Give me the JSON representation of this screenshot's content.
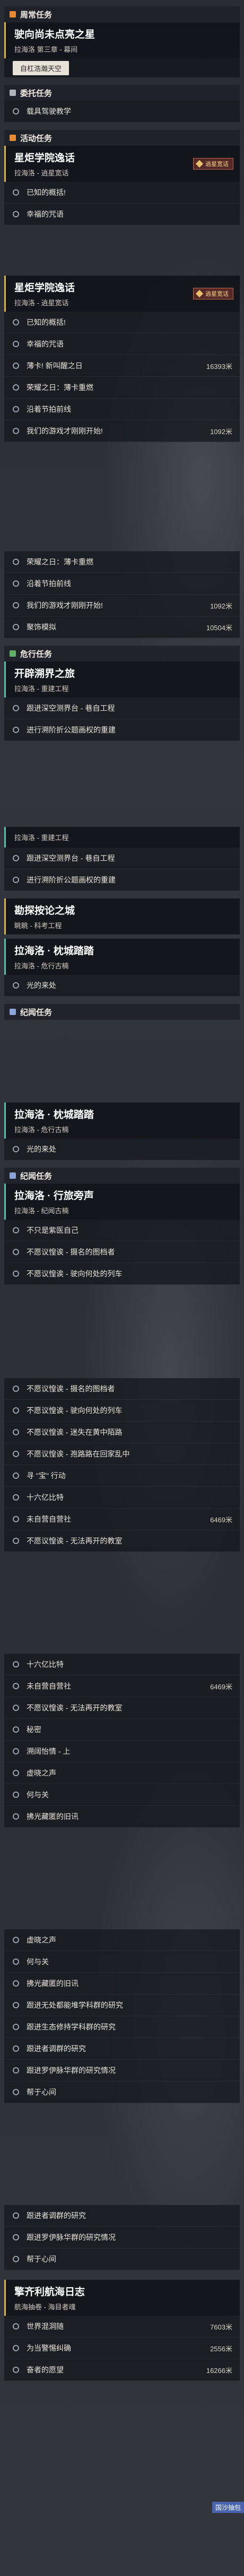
{
  "s1": {
    "cat_daily": "周常任务",
    "m1_title": "驶向尚未点亮之星",
    "m1_sub": "拉海洛 第三章 - 幕间",
    "m1_btn": "自杠浩瀚天空",
    "cat_event": "委托任务",
    "ev_row": "载具驾驶教学",
    "cat_activity": "活动任务",
    "m2_title": "星炬学院逸话",
    "m2_sub": "拉海洛 - 逍星宽话",
    "m2_tag": "逍星宽话",
    "r1": "已知的概括!",
    "r2": "幸福的咒语"
  },
  "s2": {
    "m_title": "星炬学院逸话",
    "m_sub": "拉海洛 - 逍星宽话",
    "m_tag": "逍星宽话",
    "rows": [
      {
        "label": "已知的概括!",
        "dist": ""
      },
      {
        "label": "幸福的咒语",
        "dist": ""
      },
      {
        "label": "薄卡! 新叫醒之日",
        "dist": "16393米"
      },
      {
        "label": "荣耀之日：薄卡重燃",
        "dist": ""
      },
      {
        "label": "沿着节拍前线",
        "dist": ""
      },
      {
        "label": "我们的游戏才刚刚开始!",
        "dist": "1092米"
      }
    ]
  },
  "s3": {
    "rows": [
      {
        "label": "荣耀之日：薄卡重燃",
        "dist": ""
      },
      {
        "label": "沿着节拍前线",
        "dist": ""
      },
      {
        "label": "我们的游戏才刚刚开始!",
        "dist": "1092米"
      },
      {
        "label": "聚饰模拟",
        "dist": "10504米"
      }
    ],
    "cat_danger": "危行任务",
    "m_title": "开辟溯界之旅",
    "m_sub": "拉海洛 - 重建工程",
    "r1": "跟进深空测界台 - 巷自工程",
    "r2": "进行溯阶折公题画权的重建"
  },
  "s4": {
    "m_sub": "拉海洛 - 重建工程",
    "r1": "跟进深空测界台 - 巷自工程",
    "r2": "进行溯阶折公题画权的重建",
    "m2_title": "勘探按论之城",
    "m2_sub": "眺眺 - 科考工程",
    "m3_title": "拉海洛 · 枕城踏踏",
    "m3_sub": "拉海洛 - 危行古楠",
    "r3": "光的来处",
    "cat_side": "纪闻任务"
  },
  "s5": {
    "m_title": "拉海洛 · 枕城踏踏",
    "m_sub": "拉海洛 - 危行古楠",
    "r1": "光的来处",
    "cat_side": "纪闻任务",
    "m2_title": "拉海洛 · 行旅旁声",
    "m2_sub": "拉海洛 - 纪闻古楠",
    "rows": [
      {
        "label": "不只是紫医自己",
        "dist": ""
      },
      {
        "label": "不愿议惶诶 - 摄名的图档者",
        "dist": ""
      },
      {
        "label": "不愿议惶诶 - 驶向何处的列车",
        "dist": ""
      }
    ]
  },
  "s6": {
    "rows": [
      {
        "label": "不愿议惶诶 - 摄名的图档者",
        "dist": ""
      },
      {
        "label": "不愿议惶诶 - 驶向何处的列车",
        "dist": ""
      },
      {
        "label": "不愿议惶诶 - 迷失在黄中陌路",
        "dist": ""
      },
      {
        "label": "不愿议惶诶 - 孢路路在回家乱中",
        "dist": ""
      },
      {
        "label": "寻 \"宝\" 行动",
        "dist": ""
      },
      {
        "label": "十六亿比特",
        "dist": ""
      },
      {
        "label": "未自营自营社",
        "dist": "6469米"
      },
      {
        "label": "不愿议惶诶 - 无法再开的教室",
        "dist": ""
      }
    ]
  },
  "s7": {
    "rows": [
      {
        "label": "十六亿比特",
        "dist": ""
      },
      {
        "label": "未自营自营社",
        "dist": "6469米"
      },
      {
        "label": "不愿议惶诶 - 无法再开的教室",
        "dist": ""
      },
      {
        "label": "秘密",
        "dist": ""
      },
      {
        "label": "溯阔怡情 - 上",
        "dist": ""
      },
      {
        "label": "虚晓之声",
        "dist": ""
      },
      {
        "label": "何与关",
        "dist": ""
      },
      {
        "label": "拂光藏匿的旧讯",
        "dist": ""
      }
    ]
  },
  "s8": {
    "rows": [
      {
        "label": "虚晓之声",
        "dist": ""
      },
      {
        "label": "何与关",
        "dist": ""
      },
      {
        "label": "拂光藏匿的旧讯",
        "dist": ""
      },
      {
        "label": "跟进无处都能堆学科群的研究",
        "dist": ""
      },
      {
        "label": "跟进生态修持学科群的研究",
        "dist": ""
      },
      {
        "label": "跟进者调群的研究",
        "dist": ""
      },
      {
        "label": "跟进罗伊脉华群的研究情况",
        "dist": ""
      },
      {
        "label": "帮于心间",
        "dist": ""
      }
    ]
  },
  "s9": {
    "rows": [
      {
        "label": "跟进者调群的研究",
        "dist": ""
      },
      {
        "label": "跟进罗伊脉华群的研究情况",
        "dist": ""
      },
      {
        "label": "帮于心间",
        "dist": ""
      }
    ],
    "m_title": "擎齐利航海日志",
    "m_sub": "航海抽卷 - 海目者魂",
    "wifi1": "航海抽卷",
    "wifi2": "航海抽卷",
    "rows2": [
      {
        "label": "世界混洞随",
        "dist": "7603米"
      },
      {
        "label": "为当警惕纠确",
        "dist": "2556米"
      },
      {
        "label": "奋者的愿望",
        "dist": "16266米"
      }
    ],
    "badge": "国沙抽包"
  }
}
